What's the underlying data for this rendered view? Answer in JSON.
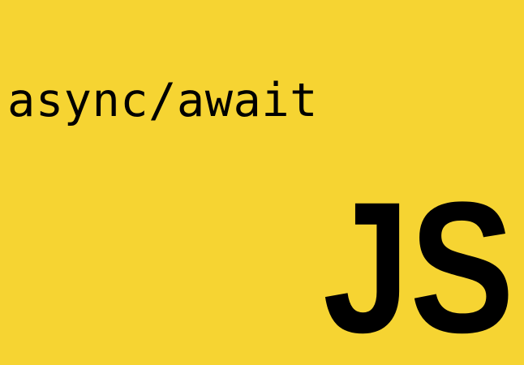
{
  "headline": "async/await",
  "logo": {
    "text": "JS",
    "icon": "javascript-logo",
    "text_color": "#000000"
  },
  "colors": {
    "background": "#f6d432",
    "text": "#000000"
  }
}
